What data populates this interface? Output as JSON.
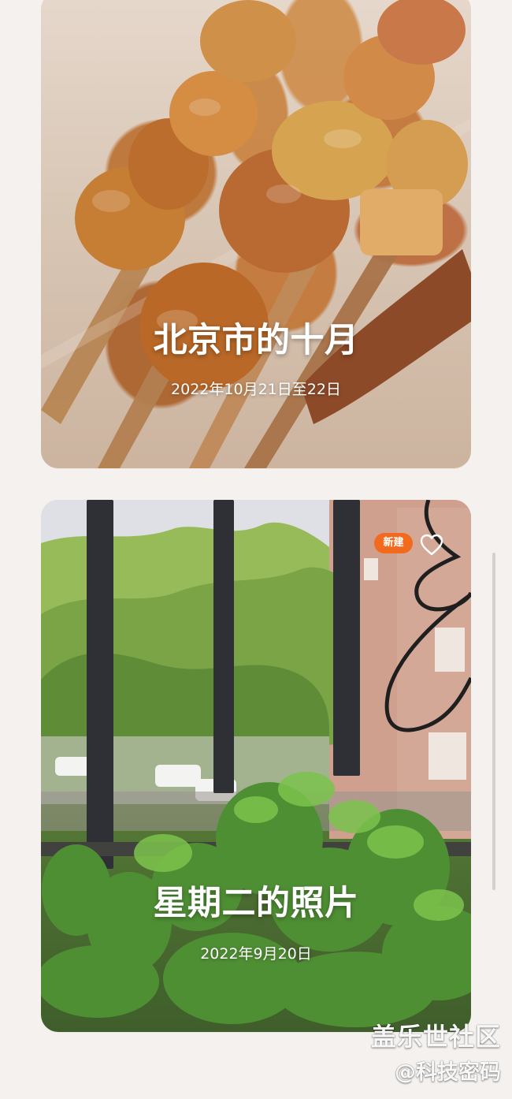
{
  "cards": [
    {
      "title": "北京市的十月",
      "date": "2022年10月21日至22日"
    },
    {
      "title": "星期二的照片",
      "date": "2022年9月20日",
      "badge": "新建",
      "favorite_icon": "heart-outline-icon"
    }
  ],
  "watermark": {
    "main": "盖乐世社区",
    "sub": "@科技密码"
  },
  "colors": {
    "background": "#f4f1ef",
    "badge": "#f26a1e",
    "text": "#ffffff"
  }
}
